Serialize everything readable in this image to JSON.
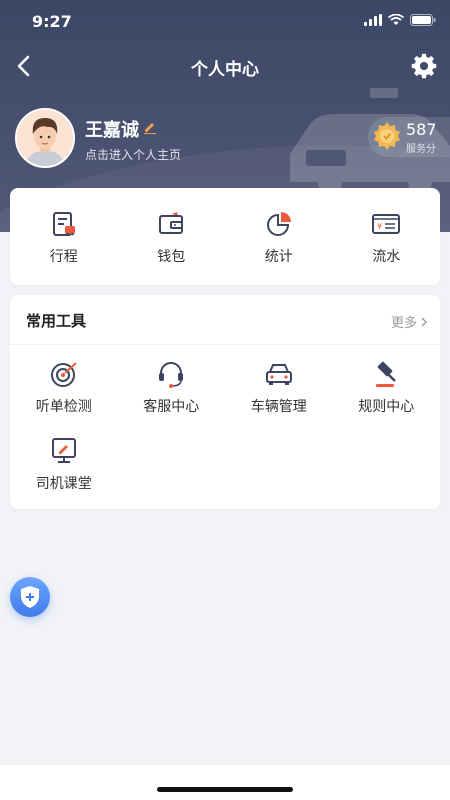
{
  "status_bar": {
    "time": "9:27"
  },
  "nav": {
    "title": "个人中心"
  },
  "profile": {
    "name": "王嘉诚",
    "subtitle": "点击进入个人主页"
  },
  "score": {
    "value": "587",
    "label": "服务分"
  },
  "quick_actions": [
    {
      "label": "行程",
      "icon": "itinerary-icon"
    },
    {
      "label": "钱包",
      "icon": "wallet-icon"
    },
    {
      "label": "统计",
      "icon": "statistics-icon"
    },
    {
      "label": "流水",
      "icon": "transactions-icon"
    }
  ],
  "tools": {
    "title": "常用工具",
    "more_label": "更多",
    "items": [
      {
        "label": "听单检测",
        "icon": "order-check-icon"
      },
      {
        "label": "客服中心",
        "icon": "customer-service-icon"
      },
      {
        "label": "车辆管理",
        "icon": "car-icon"
      },
      {
        "label": "规则中心",
        "icon": "gavel-icon"
      },
      {
        "label": "司机课堂",
        "icon": "classroom-icon"
      }
    ]
  },
  "colors": {
    "header": "#3c4766",
    "accent": "#f05a3c",
    "icon_dark": "#3e4460",
    "float_button": "#3d7be8"
  }
}
